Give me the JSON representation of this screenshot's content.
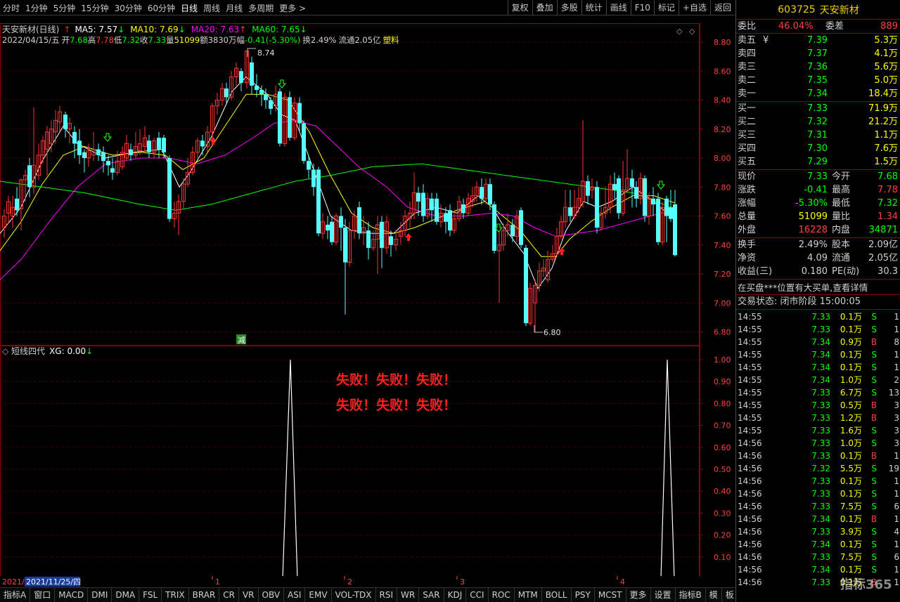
{
  "toolbar": {
    "periods": [
      "分时",
      "1分钟",
      "5分钟",
      "15分钟",
      "30分钟",
      "60分钟",
      "日线",
      "周线",
      "月线",
      "多周期",
      "更多 >"
    ],
    "active_period": "日线",
    "tools": [
      "复权",
      "叠加",
      "多股",
      "统计",
      "画线",
      "F10",
      "标记",
      "+自选",
      "返回"
    ]
  },
  "main_chart": {
    "title": "天安新材(日线)",
    "ma_labels": [
      {
        "text": "MA5: 7.57",
        "arrow": "↓",
        "color": "#ffffff"
      },
      {
        "text": "MA10: 7.69",
        "arrow": "↓",
        "color": "#ffff00"
      },
      {
        "text": "MA20: 7.63",
        "arrow": "↑",
        "color": "#ff00ff"
      },
      {
        "text": "MA60: 7.65",
        "arrow": "↓",
        "color": "#00ff00"
      }
    ],
    "info_line": {
      "date": "2022/04/15/五",
      "open_label": "开",
      "open": "7.68",
      "high_label": "高",
      "high": "7.78",
      "low_label": "低",
      "low": "7.32",
      "close_label": "收",
      "close": "7.33",
      "volume_label": "量",
      "volume": "51099",
      "amount_label": "额",
      "amount": "3830万",
      "change_label": "幅",
      "change": "-0.41(-5.30%)",
      "turnover": "换2.49%",
      "float_cap": "流通2.05亿",
      "concept": "塑料"
    },
    "y_ticks": [
      "8.80",
      "8.60",
      "8.40",
      "8.20",
      "8.00",
      "7.80",
      "7.60",
      "7.40",
      "7.20",
      "7.00",
      "6.80"
    ],
    "high_marker": "8.74",
    "low_marker": "6.80",
    "reduce_badge": "减"
  },
  "indicator_chart": {
    "title": "短线四代",
    "value_label": "XG: 0.00",
    "value_arrow": "↓",
    "y_ticks": [
      "1.00",
      "0.90",
      "0.80",
      "0.70",
      "0.60",
      "0.50",
      "0.40",
      "0.30",
      "0.20",
      "0.10"
    ],
    "fail_text_line1": "失败！失败！失败！",
    "fail_text_line2": "失败！失败！失败！"
  },
  "date_axis": {
    "left_date": "2021/",
    "cursor_date": "2021/11/25/四",
    "month_marks": [
      "1",
      "2",
      "3",
      "4"
    ]
  },
  "period_button": "日线",
  "status_bar": {
    "tabs": [
      "指标A",
      "窗口",
      "MACD",
      "DMI",
      "DMA",
      "FSL",
      "TRIX",
      "BRAR",
      "CR",
      "VR",
      "OBV",
      "ASI",
      "EMV",
      "VOL-TDX",
      "RSI",
      "WR",
      "SAR",
      "KDJ",
      "CCI",
      "ROC",
      "MTM",
      "BOLL",
      "PSY",
      "MCST",
      "更多",
      "设置"
    ],
    "right_tabs": [
      "指标B",
      "模",
      "板",
      "+",
      "-"
    ]
  },
  "quote_panel": {
    "code": "603725",
    "name": "天安新材",
    "weibi_label": "委比",
    "weibi": "46.04%",
    "weicha_label": "委差",
    "weicha": "889",
    "asks": [
      {
        "label": "卖五",
        "mark": "¥",
        "price": "7.39",
        "vol": "5.3万"
      },
      {
        "label": "卖四",
        "mark": "",
        "price": "7.37",
        "vol": "4.1万"
      },
      {
        "label": "卖三",
        "mark": "",
        "price": "7.36",
        "vol": "5.6万"
      },
      {
        "label": "卖二",
        "mark": "",
        "price": "7.35",
        "vol": "5.0万"
      },
      {
        "label": "卖一",
        "mark": "",
        "price": "7.34",
        "vol": "18.4万"
      }
    ],
    "bids": [
      {
        "label": "买一",
        "price": "7.33",
        "vol": "71.9万"
      },
      {
        "label": "买二",
        "price": "7.32",
        "vol": "21.2万"
      },
      {
        "label": "买三",
        "price": "7.31",
        "vol": "1.1万"
      },
      {
        "label": "买四",
        "price": "7.30",
        "vol": "7.6万"
      },
      {
        "label": "买五",
        "price": "7.29",
        "vol": "1.5万"
      }
    ],
    "stats1": [
      {
        "l1": "现价",
        "v1": "7.33",
        "c1": "#00ff00",
        "l2": "今开",
        "v2": "7.68",
        "c2": "#00ff00"
      },
      {
        "l1": "涨跌",
        "v1": "-0.41",
        "c1": "#00ff00",
        "l2": "最高",
        "v2": "7.78",
        "c2": "#ff4040"
      },
      {
        "l1": "涨幅",
        "v1": "-5.30%",
        "c1": "#00ff00",
        "l2": "最低",
        "v2": "7.32",
        "c2": "#00ff00"
      },
      {
        "l1": "总量",
        "v1": "51099",
        "c1": "#ffff00",
        "l2": "量比",
        "v2": "1.34",
        "c2": "#ff4040"
      },
      {
        "l1": "外盘",
        "v1": "16228",
        "c1": "#ff4040",
        "l2": "内盘",
        "v2": "34871",
        "c2": "#00ff00"
      }
    ],
    "stats2": [
      {
        "l1": "换手",
        "v1": "2.49%",
        "l2": "股本",
        "v2": "2.09亿"
      },
      {
        "l1": "净资",
        "v1": "4.09",
        "l2": "流通",
        "v2": "2.05亿"
      },
      {
        "l1": "收益(三)",
        "v1": "0.180",
        "l2": "PE(动)",
        "v2": "30.3"
      }
    ],
    "notice": "在买盘***位置有大买单,查看详情",
    "trade_status": "交易状态: 闭市阶段 15:00:05",
    "ticks": [
      {
        "t": "14:55",
        "p": "7.33",
        "v": "0.1万",
        "s": "S",
        "n": "1"
      },
      {
        "t": "14:55",
        "p": "7.33",
        "v": "0.1万",
        "s": "S",
        "n": "1"
      },
      {
        "t": "14:55",
        "p": "7.34",
        "v": "0.9万",
        "s": "B",
        "n": "8"
      },
      {
        "t": "14:55",
        "p": "7.34",
        "v": "0.1万",
        "s": "S",
        "n": "1"
      },
      {
        "t": "14:55",
        "p": "7.34",
        "v": "0.1万",
        "s": "S",
        "n": "1"
      },
      {
        "t": "14:55",
        "p": "7.34",
        "v": "1.0万",
        "s": "S",
        "n": "2"
      },
      {
        "t": "14:55",
        "p": "7.33",
        "v": "6.7万",
        "s": "S",
        "n": "13"
      },
      {
        "t": "14:55",
        "p": "7.33",
        "v": "0.5万",
        "s": "B",
        "n": "3"
      },
      {
        "t": "14:55",
        "p": "7.33",
        "v": "1.2万",
        "s": "B",
        "n": "3"
      },
      {
        "t": "14:55",
        "p": "7.33",
        "v": "1.6万",
        "s": "S",
        "n": "3"
      },
      {
        "t": "14:56",
        "p": "7.33",
        "v": "1.0万",
        "s": "S",
        "n": "3"
      },
      {
        "t": "14:56",
        "p": "7.33",
        "v": "0.1万",
        "s": "B",
        "n": "1"
      },
      {
        "t": "14:56",
        "p": "7.32",
        "v": "5.5万",
        "s": "S",
        "n": "19"
      },
      {
        "t": "14:56",
        "p": "7.33",
        "v": "0.1万",
        "s": "S",
        "n": "1"
      },
      {
        "t": "14:56",
        "p": "7.33",
        "v": "0.1万",
        "s": "S",
        "n": "1"
      },
      {
        "t": "14:56",
        "p": "7.33",
        "v": "7.5万",
        "s": "S",
        "n": "6"
      },
      {
        "t": "14:56",
        "p": "7.34",
        "v": "0.1万",
        "s": "B",
        "n": "1"
      },
      {
        "t": "14:56",
        "p": "7.33",
        "v": "3.9万",
        "s": "S",
        "n": "4"
      },
      {
        "t": "14:56",
        "p": "7.34",
        "v": "0.1万",
        "s": "S",
        "n": "1"
      },
      {
        "t": "14:56",
        "p": "7.33",
        "v": "7.5万",
        "s": "S",
        "n": "6"
      },
      {
        "t": "14:56",
        "p": "7.34",
        "v": "0.1万",
        "s": "S",
        "n": "1"
      },
      {
        "t": "14:56",
        "p": "7.33",
        "v": "0.1万",
        "s": "B",
        "n": "1"
      }
    ],
    "watermark": "指标365"
  },
  "colors": {
    "up": "#ff3232",
    "down": "#54ffff",
    "ma5": "#ffffff",
    "ma10": "#ffff00",
    "ma20": "#ff00ff",
    "ma60": "#00ff00",
    "grid": "#8b0000",
    "price_red": "#ff4040",
    "price_green": "#00ff00"
  }
}
